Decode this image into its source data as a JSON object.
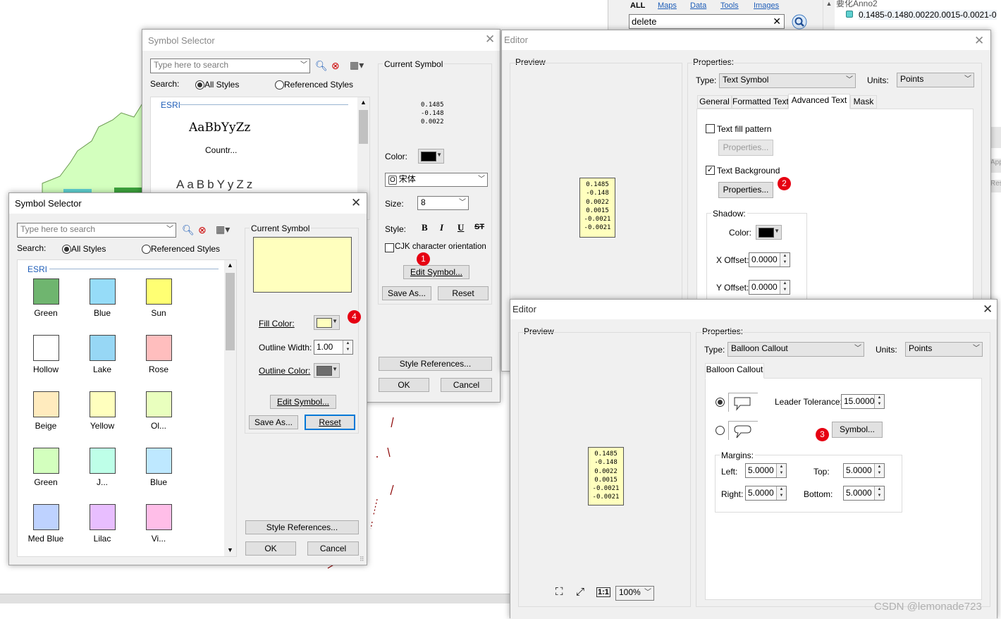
{
  "search_bar": {
    "links": [
      "ALL",
      "Maps",
      "Data",
      "Tools",
      "Images"
    ],
    "query": "delete"
  },
  "toc": {
    "layer_partial": "要化Anno2",
    "entry": "0.1485-0.1480.00220.0015-0.0021-0"
  },
  "selector_bg": {
    "title": "Symbol Selector",
    "search_placeholder": "Type here to search",
    "search_label": "Search:",
    "all_styles": "All Styles",
    "referenced_styles": "Referenced Styles",
    "group": "ESRI",
    "sample1": "AaBbYyZz",
    "sample1_label": "Countr...",
    "sample2": "AaBbYyZz",
    "current_symbol": "Current Symbol",
    "preview_lines": [
      "0.1485",
      "-0.148",
      "0.0022"
    ],
    "color_label": "Color:",
    "font": "宋体",
    "size_label": "Size:",
    "size": "8",
    "style_label": "Style:",
    "style_buttons": [
      "B",
      "I",
      "U",
      "ST"
    ],
    "cjk_label": "CJK character orientation",
    "edit_symbol": "Edit Symbol...",
    "save_as": "Save As...",
    "reset": "Reset",
    "style_references": "Style References...",
    "ok": "OK",
    "cancel": "Cancel"
  },
  "selector_fg": {
    "title": "Symbol Selector",
    "search_placeholder": "Type here to search",
    "search_label": "Search:",
    "all_styles": "All Styles",
    "referenced_styles": "Referenced Styles",
    "group": "ESRI",
    "swatches": [
      {
        "label": "Green",
        "color": "#6fb56f"
      },
      {
        "label": "Blue",
        "color": "#96dcf8"
      },
      {
        "label": "Sun",
        "color": "#ffff73"
      },
      {
        "label": "Hollow",
        "color": "#ffffff"
      },
      {
        "label": "Lake",
        "color": "#97d7f5"
      },
      {
        "label": "Rose",
        "color": "#ffbebe"
      },
      {
        "label": "Beige",
        "color": "#ffebbe"
      },
      {
        "label": "Yellow",
        "color": "#ffffbe"
      },
      {
        "label": "Ol...",
        "color": "#e9ffbe"
      },
      {
        "label": "Green",
        "color": "#d3ffbe"
      },
      {
        "label": "J...",
        "color": "#beffe8"
      },
      {
        "label": "Blue",
        "color": "#bee8ff"
      },
      {
        "label": "Med Blue",
        "color": "#bed2ff"
      },
      {
        "label": "Lilac",
        "color": "#e8beff"
      },
      {
        "label": "Vi...",
        "color": "#ffbee8"
      }
    ],
    "current_symbol": "Current Symbol",
    "preview_color": "#ffffbe",
    "fill_color_label": "Fill Color:",
    "fill_color": "#ffffbe",
    "outline_width_label": "Outline Width:",
    "outline_width": "1.00",
    "outline_color_label": "Outline Color:",
    "outline_color": "#6e6e6e",
    "edit_symbol": "Edit Symbol...",
    "save_as": "Save As...",
    "reset": "Reset",
    "style_references": "Style References...",
    "ok": "OK",
    "cancel": "Cancel"
  },
  "editor_bg": {
    "title": "Editor",
    "preview": "Preview",
    "properties": "Properties:",
    "type_label": "Type:",
    "type": "Text Symbol",
    "units_label": "Units:",
    "units": "Points",
    "tabs": [
      "General",
      "Formatted Text",
      "Advanced Text",
      "Mask"
    ],
    "text_fill_pattern": "Text fill pattern",
    "properties_btn": "Properties...",
    "text_background": "Text Background",
    "shadow": "Shadow:",
    "color_label": "Color:",
    "x_offset_label": "X Offset:",
    "x_offset": "0.0000",
    "y_offset_label": "Y Offset:",
    "y_offset": "0.0000",
    "preview_lines": [
      "0.1485",
      "-0.148",
      "0.0022",
      "0.0015",
      "-0.0021",
      "-0.0021"
    ]
  },
  "editor_fg": {
    "title": "Editor",
    "preview": "Preview",
    "properties": "Properties:",
    "type_label": "Type:",
    "type": "Balloon Callout",
    "units_label": "Units:",
    "units": "Points",
    "tab": "Balloon Callout",
    "leader_tolerance_label": "Leader Tolerance:",
    "leader_tolerance": "15.0000",
    "symbol_btn": "Symbol...",
    "margins": "Margins:",
    "left_label": "Left:",
    "left": "5.0000",
    "top_label": "Top:",
    "top": "5.0000",
    "right_label": "Right:",
    "right": "5.0000",
    "bottom_label": "Bottom:",
    "bottom": "5.0000",
    "zoom": "100%",
    "preview_lines": [
      "0.1485",
      "-0.148",
      "0.0022",
      "0.0015",
      "-0.0021",
      "-0.0021"
    ]
  },
  "badges": [
    "1",
    "2",
    "3",
    "4"
  ],
  "watermark": "CSDN @lemonade723"
}
